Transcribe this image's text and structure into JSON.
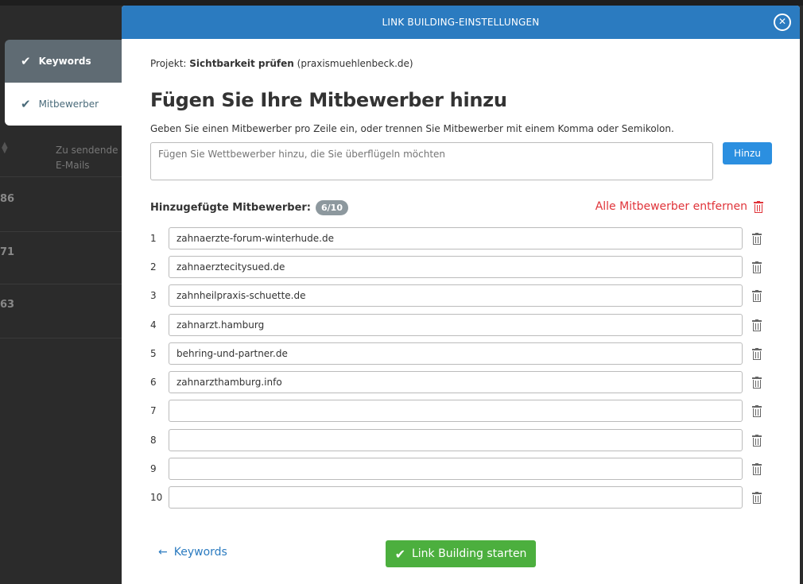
{
  "background": {
    "steps": [
      {
        "label": "Keywords"
      },
      {
        "label": "Mitbewerber"
      }
    ],
    "column_header": [
      "Zu sendende",
      "E-Mails"
    ],
    "row_numbers": [
      "86",
      "71",
      "63"
    ]
  },
  "modal": {
    "title": "LINK BUILDING-EINSTELLUNGEN",
    "project_prefix": "Projekt:",
    "project_name": "Sichtbarkeit prüfen",
    "project_domain": "(praxismuehlenbeck.de)",
    "heading": "Fügen Sie Ihre Mitbewerber hinzu",
    "hint": "Geben Sie einen Mitbewerber pro Zeile ein, oder trennen Sie Mitbewerber mit einem Komma oder Semikolon.",
    "add_input_placeholder": "Fügen Sie Wettbewerber hinzu, die Sie überflügeln möchten",
    "add_button": "Hinzu",
    "added_label": "Hinzugefügte Mitbewerber:",
    "added_count": "6/10",
    "remove_all": "Alle Mitbewerber entfernen",
    "competitors": [
      {
        "index": "1",
        "value": "zahnaerzte-forum-winterhude.de"
      },
      {
        "index": "2",
        "value": "zahnaerztecitysued.de"
      },
      {
        "index": "3",
        "value": "zahnheilpraxis-schuette.de"
      },
      {
        "index": "4",
        "value": "zahnarzt.hamburg"
      },
      {
        "index": "5",
        "value": "behring-und-partner.de"
      },
      {
        "index": "6",
        "value": "zahnarzthamburg.info"
      },
      {
        "index": "7",
        "value": ""
      },
      {
        "index": "8",
        "value": ""
      },
      {
        "index": "9",
        "value": ""
      },
      {
        "index": "10",
        "value": ""
      }
    ],
    "back_link": "Keywords",
    "start_button": "Link Building starten"
  },
  "colors": {
    "header_blue": "#2b7bc0",
    "button_blue": "#2b8fe0",
    "start_green": "#4caf3e",
    "danger_red": "#e0343a",
    "badge_gray": "#8d989e"
  }
}
